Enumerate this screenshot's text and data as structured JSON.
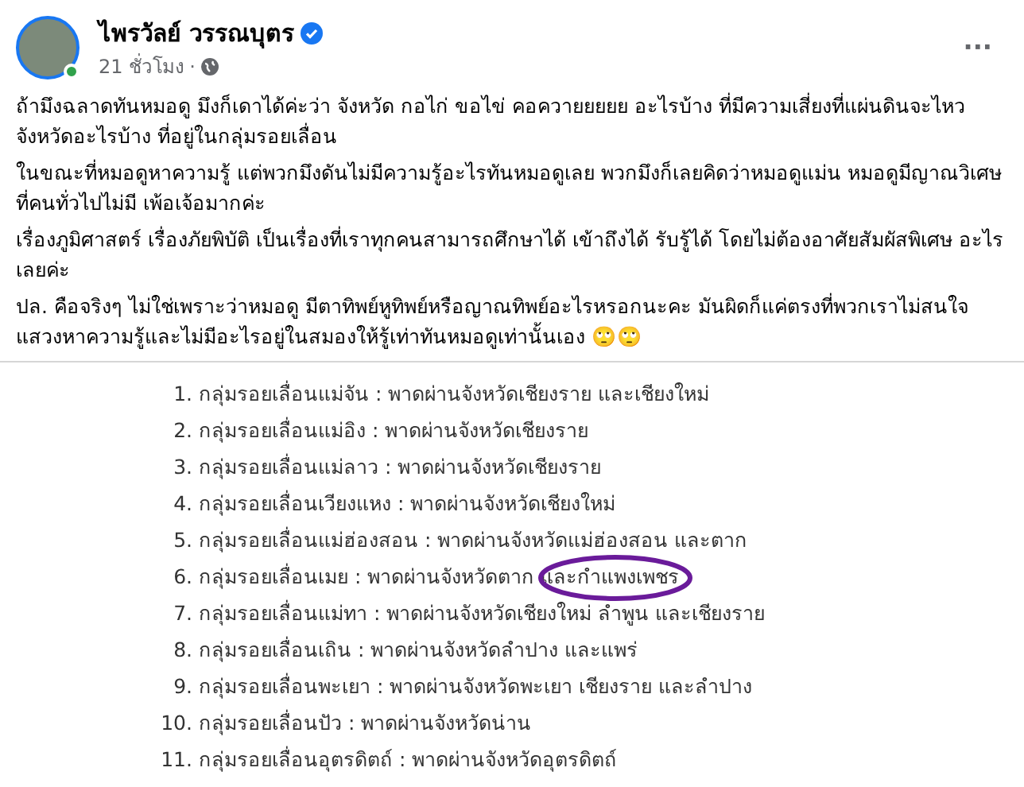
{
  "post": {
    "author": "ไพรวัลย์ วรรณบุตร",
    "verified": true,
    "online": true,
    "time": "21 ชั่วโมง",
    "separator": "·",
    "more": "···",
    "paragraphs": [
      "ถ้ามึงฉลาดทันหมอดู มึงก็เดาได้ค่ะว่า จังหวัด กอไก่ ขอไข่ คอควายยยยย อะไรบ้าง ที่มีความเสี่ยงที่แผ่นดินจะไหว จังหวัดอะไรบ้าง ที่อยู่ในกลุ่มรอยเลื่อน",
      "ในขณะที่หมอดูหาความรู้ แต่พวกมึงดันไม่มีความรู้อะไรทันหมอดูเลย พวกมึงก็เลยคิดว่าหมอดูแม่น หมอดูมีญาณวิเศษที่คนทั่วไปไม่มี เพ้อเจ้อมากค่ะ",
      "เรื่องภูมิศาสตร์ เรื่องภัยพิบัติ เป็นเรื่องที่เราทุกคนสามารถศึกษาได้ เข้าถึงได้ รับรู้ได้ โดยไม่ต้องอาศัยสัมผัสพิเศษ อะไรเลยค่ะ",
      "ปล. คือจริงๆ ไม่ใช่เพราะว่าหมอดู มีตาทิพย์หูทิพย์หรือญาณทิพย์อะไรหรอกนะคะ มันผิดก็แค่ตรงที่พวกเราไม่สนใจแสวงหาความรู้และไม่มีอะไรอยู่ในสมองให้รู้เท่าทันหมอดูเท่านั้นเอง 🙄🙄"
    ]
  },
  "image": {
    "items": [
      {
        "number": "1.",
        "text": "กลุ่มรอยเลื่อนแม่จัน : พาดผ่านจังหวัดเชียงราย และเชียงใหม่",
        "circled": false
      },
      {
        "number": "2.",
        "text": "กลุ่มรอยเลื่อนแม่อิง : พาดผ่านจังหวัดเชียงราย",
        "circled": false
      },
      {
        "number": "3.",
        "text": "กลุ่มรอยเลื่อนแม่ลาว : พาดผ่านจังหวัดเชียงราย",
        "circled": false
      },
      {
        "number": "4.",
        "text": "กลุ่มรอยเลื่อนเวียงแหง : พาดผ่านจังหวัดเชียงใหม่",
        "circled": false
      },
      {
        "number": "5.",
        "text": "กลุ่มรอยเลื่อนแม่ฮ่องสอน : พาดผ่านจังหวัดแม่ฮ่องสอน และตาก",
        "circled": false
      },
      {
        "number": "6.",
        "text": "กลุ่มรอยเลื่อนเมย : พาดผ่านจังหวัดตาก และกำแพงเพชร",
        "circled": true
      },
      {
        "number": "7.",
        "text": "กลุ่มรอยเลื่อนแม่ทา : พาดผ่านจังหวัดเชียงใหม่ ลำพูน และเชียงราย",
        "circled": false
      },
      {
        "number": "8.",
        "text": "กลุ่มรอยเลื่อนเถิน : พาดผ่านจังหวัดลำปาง และแพร่",
        "circled": false
      },
      {
        "number": "9.",
        "text": "กลุ่มรอยเลื่อนพะเยา : พาดผ่านจังหวัดพะเยา เชียงราย และลำปาง",
        "circled": false
      },
      {
        "number": "10.",
        "text": "กลุ่มรอยเลื่อนปัว : พาดผ่านจังหวัดน่าน",
        "circled": false
      },
      {
        "number": "11.",
        "text": "กลุ่มรอยเลื่อนอุตรดิตถ์ : พาดผ่านจังหวัดอุตรดิตถ์",
        "circled": false
      }
    ]
  }
}
